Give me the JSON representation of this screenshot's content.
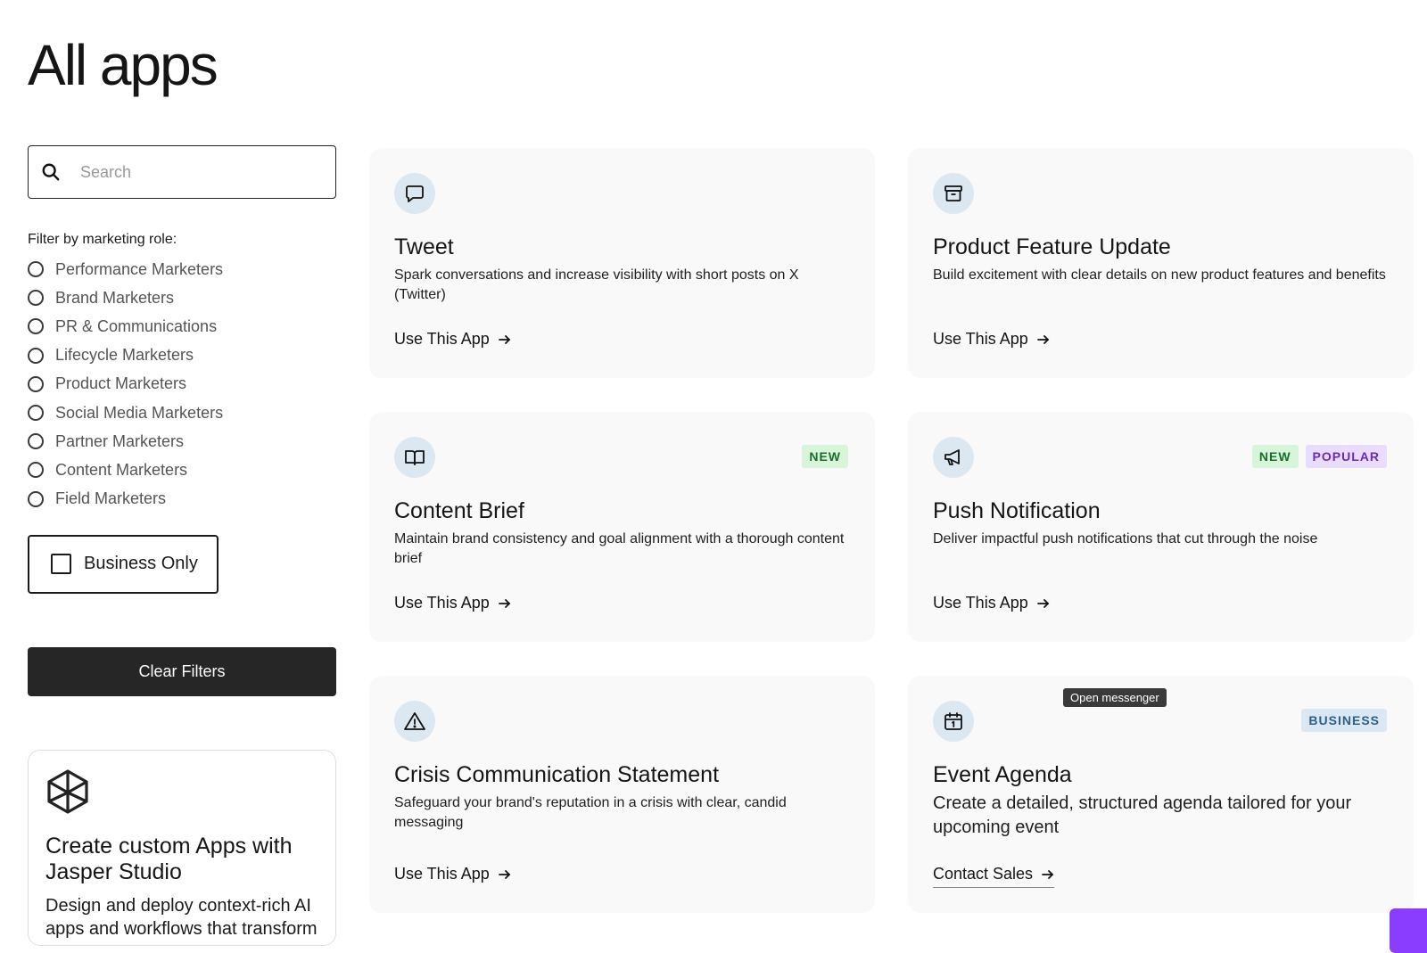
{
  "page": {
    "title": "All apps"
  },
  "search": {
    "placeholder": "Search",
    "icon": "search-icon"
  },
  "filters": {
    "label": "Filter by marketing role:",
    "roles": [
      "Performance Marketers",
      "Brand Marketers",
      "PR & Communications",
      "Lifecycle Marketers",
      "Product Marketers",
      "Social Media Marketers",
      "Partner Marketers",
      "Content Marketers",
      "Field Marketers"
    ],
    "business_only": "Business Only",
    "clear": "Clear Filters"
  },
  "promo": {
    "icon": "cube-icon",
    "title": "Create custom Apps with Jasper Studio",
    "description": "Design and deploy context-rich AI apps and workflows that transform"
  },
  "cards": [
    {
      "title": "Tweet",
      "description": "Spark conversations and increase visibility with short posts on X (Twitter)",
      "link": "Use This App",
      "icon": "chat-bubble-icon",
      "badges": []
    },
    {
      "title": "Product Feature Update",
      "description": "Build excitement with clear details on new product features and benefits",
      "link": "Use This App",
      "icon": "archive-box-icon",
      "badges": []
    },
    {
      "title": "Content Brief",
      "description": "Maintain brand consistency and goal alignment with a thorough content brief",
      "link": "Use This App",
      "icon": "book-open-icon",
      "badges": [
        "NEW"
      ]
    },
    {
      "title": "Push Notification",
      "description": "Deliver impactful push notifications that cut through the noise",
      "link": "Use This App",
      "icon": "megaphone-icon",
      "badges": [
        "NEW",
        "POPULAR"
      ]
    },
    {
      "title": "Crisis Communication Statement",
      "description": "Safeguard your brand's reputation in a crisis with clear, candid messaging",
      "link": "Use This App",
      "icon": "warning-icon",
      "badges": []
    },
    {
      "title": "Event Agenda",
      "description": "Create a detailed, structured agenda tailored for your upcoming event",
      "link": "Contact Sales",
      "icon": "calendar-icon",
      "badges": [
        "BUSINESS"
      ]
    }
  ],
  "tooltip": "Open messenger",
  "colors": {
    "badge_new_bg": "#d6f5d9",
    "badge_popular_bg": "#eadcfd",
    "badge_business_bg": "#dbe8f4",
    "icon_circle_bg": "#dce8f1",
    "button_dark": "#262626",
    "messenger": "#8b3dff"
  }
}
